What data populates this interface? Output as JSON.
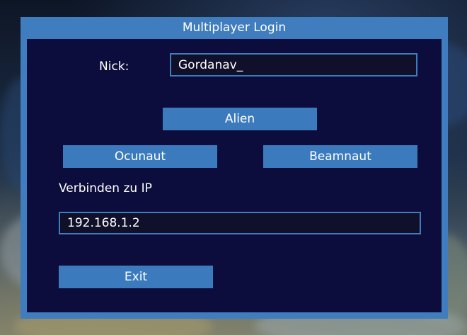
{
  "window": {
    "title": "Multiplayer Login"
  },
  "nick": {
    "label": "Nick:",
    "value": "Gordanav_"
  },
  "race_buttons": {
    "alien": "Alien",
    "ocunaut": "Ocunaut",
    "beamnaut": "Beamnaut"
  },
  "connect": {
    "label": "Verbinden zu IP",
    "value": "192.168.1.2"
  },
  "exit_button": "Exit",
  "colors": {
    "frame": "#3f7dbe",
    "panel": "#0d0d3d",
    "button": "#3b7bbd",
    "text": "#ffffff"
  }
}
